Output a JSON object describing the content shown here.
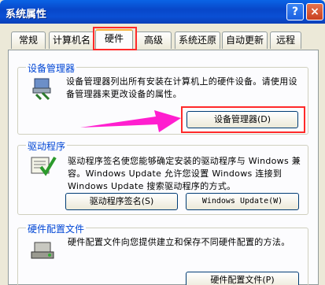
{
  "window": {
    "title": "系统属性",
    "help_label": "?",
    "close_label": "×"
  },
  "tabs": [
    {
      "label": "常规",
      "active": false
    },
    {
      "label": "计算机名",
      "active": false
    },
    {
      "label": "硬件",
      "active": true
    },
    {
      "label": "高级",
      "active": false
    },
    {
      "label": "系统还原",
      "active": false
    },
    {
      "label": "自动更新",
      "active": false
    },
    {
      "label": "远程",
      "active": false
    }
  ],
  "device_manager": {
    "group_label": "设备管理器",
    "description": "设备管理器列出所有安装在计算机上的硬件设备。请使用设备管理器来更改设备的属性。",
    "button_label": "设备管理器(D)"
  },
  "drivers": {
    "group_label": "驱动程序",
    "description": "驱动程序签名使您能够确定安装的驱动程序与 Windows 兼容。Windows Update 允许您设置 Windows 连接到 Windows Update 搜索驱动程序的方式。",
    "signing_button_label": "驱动程序签名(S)",
    "update_button_label": "Windows Update(W)"
  },
  "hardware_profiles": {
    "group_label": "硬件配置文件",
    "description": "硬件配置文件向您提供建立和保存不同硬件配置的方法。",
    "button_label": "硬件配置文件(P)"
  },
  "colors": {
    "annotation_red": "#ff2a2a",
    "arrow_magenta": "#ff1ecf",
    "group_label_blue": "#0046d5"
  }
}
